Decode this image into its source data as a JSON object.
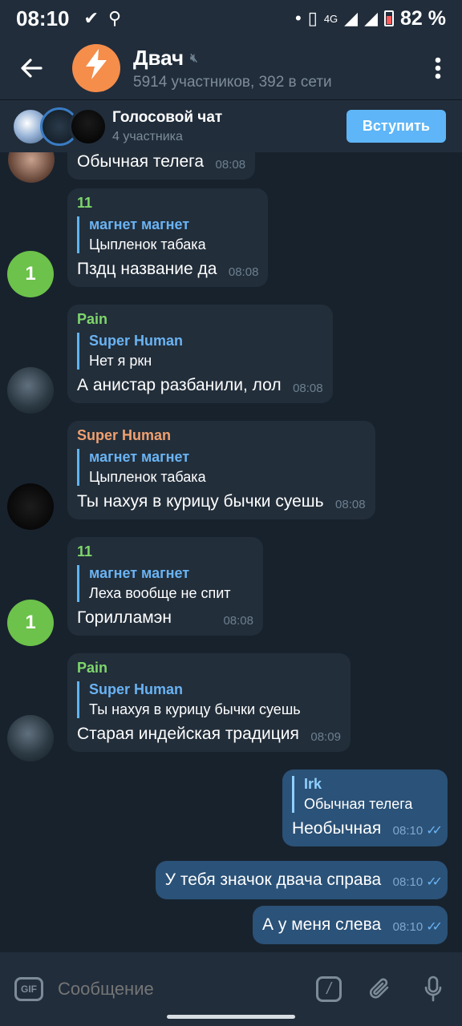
{
  "status_bar": {
    "time": "08:10",
    "network": "4G",
    "battery": "82 %"
  },
  "header": {
    "title": "Двач",
    "subtitle": "5914 участников, 392 в сети",
    "icons": [
      "back-arrow-icon",
      "lightning-icon",
      "mute-icon",
      "more-vert-icon"
    ]
  },
  "voice_chat": {
    "title": "Голосовой чат",
    "subtitle": "4 участника",
    "join_label": "Вступить"
  },
  "messages": [
    {
      "text": "Обычная телега",
      "time": "08:08"
    },
    {
      "sender": "11",
      "sender_color": "#7ed66c",
      "avatar_letter": "1",
      "reply_name": "магнет магнет",
      "reply_text": "Цыпленок табака",
      "text": "Пздц название да",
      "time": "08:08"
    },
    {
      "sender": "Pain",
      "sender_color": "#7ed66c",
      "reply_name": "Super Human",
      "reply_text": "Нет я ркн",
      "text": "А анистар разбанили, лол",
      "time": "08:08"
    },
    {
      "sender": "Super Human",
      "sender_color": "#f0a070",
      "reply_name": "магнет магнет",
      "reply_text": "Цыпленок табака",
      "text": "Ты нахуя в курицу бычки суешь",
      "time": "08:08"
    },
    {
      "sender": "11",
      "sender_color": "#7ed66c",
      "avatar_letter": "1",
      "reply_name": "магнет магнет",
      "reply_text": "Леха вообще не спит",
      "text": "Горилламэн",
      "time": "08:08"
    },
    {
      "sender": "Pain",
      "sender_color": "#7ed66c",
      "reply_name": "Super Human",
      "reply_text": "Ты нахуя в курицу бычки суешь",
      "text": "Старая индейская традиция",
      "time": "08:09"
    },
    {
      "outgoing": true,
      "reply_name": "Irk",
      "reply_text": "Обычная телега",
      "text": "Необычная",
      "time": "08:10"
    },
    {
      "outgoing": true,
      "text": "У тебя значок двача справа",
      "time": "08:10"
    },
    {
      "outgoing": true,
      "text": "А у меня слева",
      "time": "08:10"
    }
  ],
  "input": {
    "placeholder": "Сообщение",
    "gif_label": "GIF",
    "command_label": "/"
  },
  "colors": {
    "background": "#18222d",
    "header": "#212d3b",
    "bubble_in": "#222e3a",
    "bubble_out": "#2b5278",
    "accent": "#5eb5f7"
  }
}
